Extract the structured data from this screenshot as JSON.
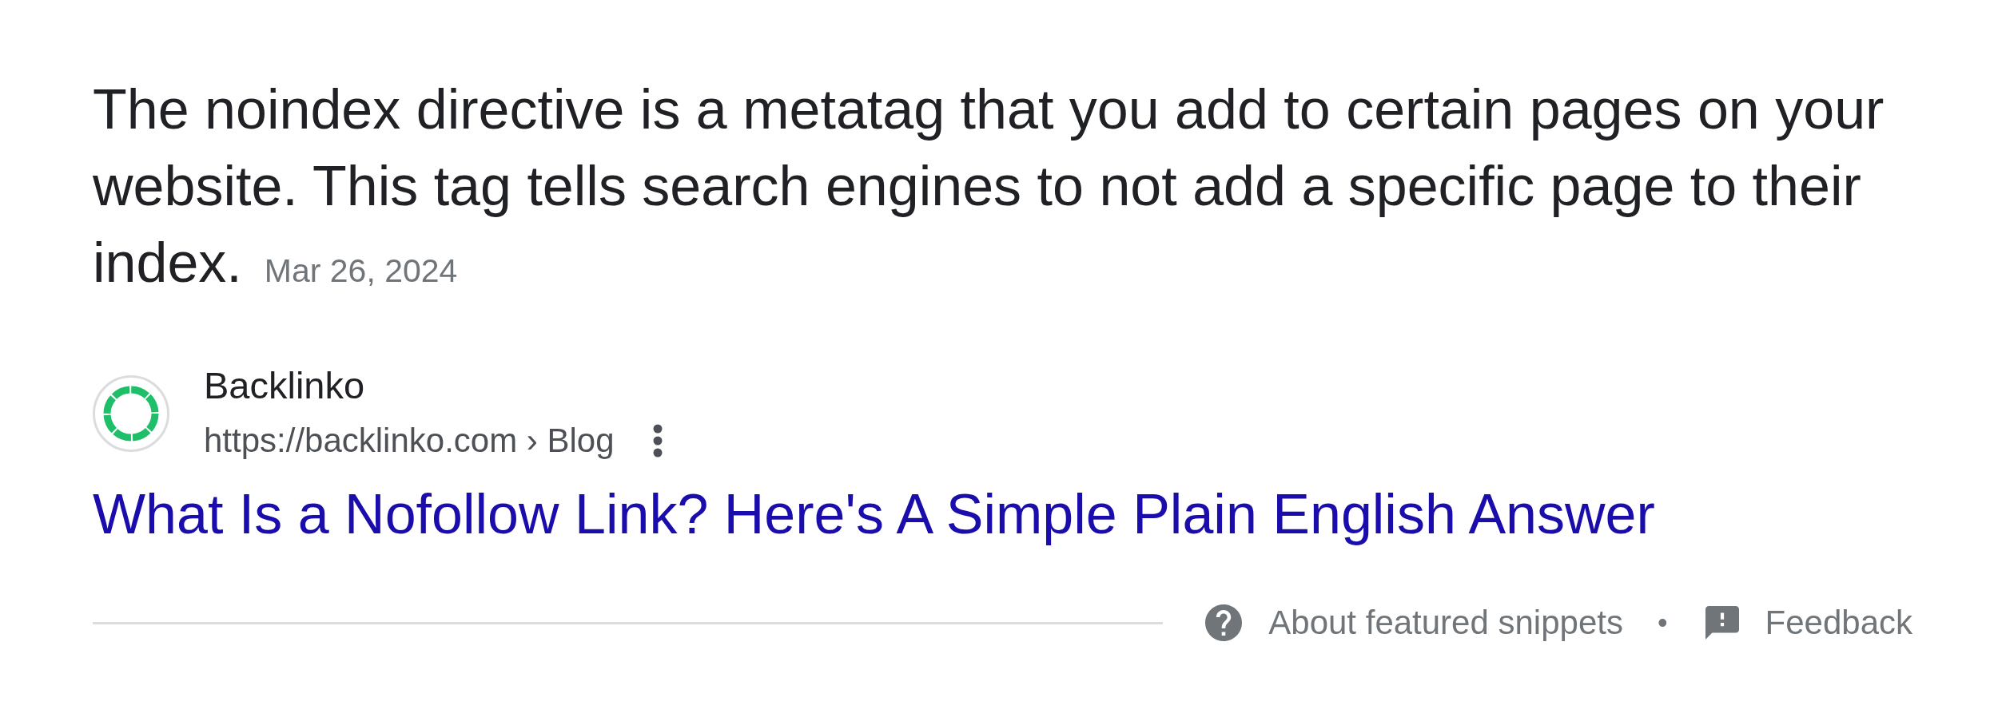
{
  "snippet": {
    "text": "The noindex directive is a metatag that you add to certain pages on your website. This tag tells search engines to not add a specific page to their index.",
    "date": "Mar 26, 2024"
  },
  "source": {
    "name": "Backlinko",
    "url": "https://backlinko.com › Blog"
  },
  "result_title": "What Is a Nofollow Link? Here's A Simple Plain English Answer",
  "footer": {
    "links": [
      {
        "kind": "help",
        "label": "About featured snippets"
      },
      {
        "kind": "feedback",
        "label": "Feedback"
      }
    ],
    "separator": "•"
  }
}
